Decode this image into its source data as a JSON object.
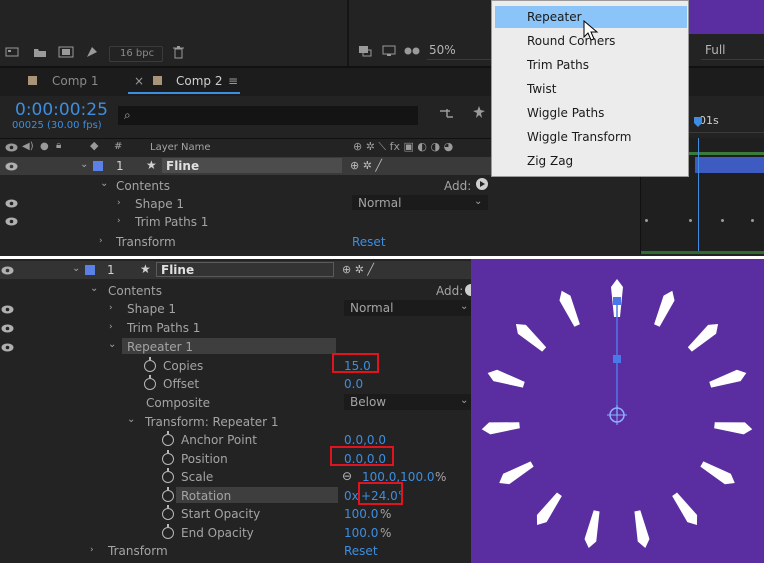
{
  "top": {
    "bpc": "16 bpc",
    "zoom": "50%",
    "resolution": "Full",
    "tabs": [
      {
        "label": "Comp 1"
      },
      {
        "label": "Comp 2"
      }
    ],
    "timecode": "0:00:00:25",
    "frames": "00025 (30.00 fps)",
    "search_placeholder": "",
    "col_hash": "#",
    "col_layer_name": "Layer Name",
    "ruler_label": "01s",
    "layer": {
      "index": "1",
      "name": "Fline"
    },
    "rows": {
      "contents": "Contents",
      "add": "Add:",
      "shape1": "Shape 1",
      "trim": "Trim Paths 1",
      "transform": "Transform",
      "blend": "Normal",
      "reset": "Reset"
    },
    "menu": [
      "Repeater",
      "Round Corners",
      "Trim Paths",
      "Twist",
      "Wiggle Paths",
      "Wiggle Transform",
      "Zig Zag"
    ]
  },
  "bottom": {
    "layer": {
      "index": "1",
      "name": "Fline"
    },
    "contents": "Contents",
    "add": "Add:",
    "shape1": "Shape 1",
    "blend": "Normal",
    "trim": "Trim Paths 1",
    "repeater": "Repeater 1",
    "copies_label": "Copies",
    "copies": "15.0",
    "offset_label": "Offset",
    "offset": "0.0",
    "composite_label": "Composite",
    "composite": "Below",
    "transform_rep": "Transform: Repeater 1",
    "anchor_label": "Anchor Point",
    "anchor": "0.0,0.0",
    "position_label": "Position",
    "position": "0.0,0.0",
    "scale_label": "Scale",
    "scale": "100.0,100.0",
    "scale_unit": "%",
    "rotation_label": "Rotation",
    "rotation_x": "0x",
    "rotation": "+24.0°",
    "start_op_label": "Start Opacity",
    "start_op": "100.0",
    "end_op_label": "End Opacity",
    "end_op": "100.0",
    "pct": "%",
    "transform": "Transform",
    "reset": "Reset"
  },
  "colors": {
    "accent": "#3d8ee0",
    "highlight": "#8ac4f8",
    "purple": "#5a2ea0",
    "red": "#e0141e"
  }
}
